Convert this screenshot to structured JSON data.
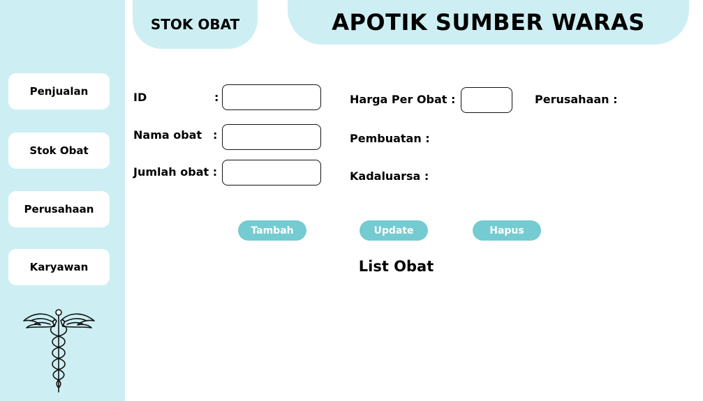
{
  "sidebar": {
    "items": [
      {
        "label": "Penjualan"
      },
      {
        "label": "Stok Obat"
      },
      {
        "label": "Perusahaan"
      },
      {
        "label": "Karyawan"
      }
    ],
    "logo_icon": "caduceus-icon"
  },
  "page_tab": {
    "title": "STOK OBAT"
  },
  "header": {
    "title": "APOTIK SUMBER WARAS"
  },
  "form": {
    "id": {
      "label": "ID",
      "colon": ":",
      "value": ""
    },
    "nama": {
      "label": "Nama obat",
      "colon": ":",
      "value": ""
    },
    "jumlah": {
      "label": "Jumlah obat :",
      "value": ""
    },
    "harga": {
      "label": "Harga Per Obat  :",
      "value": ""
    },
    "perusahaan": {
      "label": "Perusahaan :"
    },
    "pembuatan": {
      "label": "Pembuatan :"
    },
    "kadaluarsa": {
      "label": "Kadaluarsa :"
    }
  },
  "actions": {
    "tambah": "Tambah",
    "update": "Update",
    "hapus": "Hapus"
  },
  "list": {
    "title": "List Obat"
  },
  "colors": {
    "panel": "#cdeff3",
    "button": "#74cbd1",
    "background": "#ffffff"
  }
}
